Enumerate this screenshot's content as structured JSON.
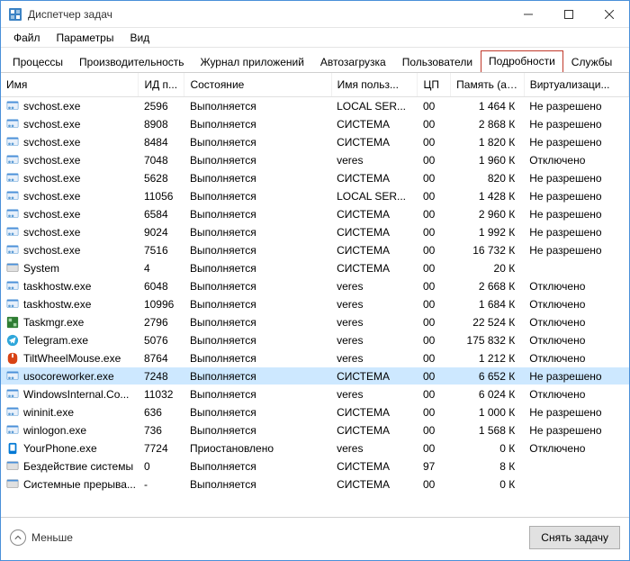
{
  "window": {
    "title": "Диспетчер задач"
  },
  "menu": {
    "file": "Файл",
    "options": "Параметры",
    "view": "Вид"
  },
  "tabs": {
    "processes": "Процессы",
    "performance": "Производительность",
    "app_history": "Журнал приложений",
    "startup": "Автозагрузка",
    "users": "Пользователи",
    "details": "Подробности",
    "services": "Службы",
    "active": "details"
  },
  "columns": {
    "name": "Имя",
    "pid": "ИД п...",
    "state": "Состояние",
    "user": "Имя польз...",
    "cpu": "ЦП",
    "mem": "Память (ак...",
    "virt": "Виртуализаци..."
  },
  "footer": {
    "fewer": "Меньше",
    "end_task": "Снять задачу"
  },
  "rows": [
    {
      "icon": "svc",
      "name": "svchost.exe",
      "pid": "2596",
      "state": "Выполняется",
      "user": "LOCAL SER...",
      "cpu": "00",
      "mem": "1 464 К",
      "virt": "Не разрешено"
    },
    {
      "icon": "svc",
      "name": "svchost.exe",
      "pid": "8908",
      "state": "Выполняется",
      "user": "СИСТЕМА",
      "cpu": "00",
      "mem": "2 868 К",
      "virt": "Не разрешено"
    },
    {
      "icon": "svc",
      "name": "svchost.exe",
      "pid": "8484",
      "state": "Выполняется",
      "user": "СИСТЕМА",
      "cpu": "00",
      "mem": "1 820 К",
      "virt": "Не разрешено"
    },
    {
      "icon": "svc",
      "name": "svchost.exe",
      "pid": "7048",
      "state": "Выполняется",
      "user": "veres",
      "cpu": "00",
      "mem": "1 960 К",
      "virt": "Отключено"
    },
    {
      "icon": "svc",
      "name": "svchost.exe",
      "pid": "5628",
      "state": "Выполняется",
      "user": "СИСТЕМА",
      "cpu": "00",
      "mem": "820 К",
      "virt": "Не разрешено"
    },
    {
      "icon": "svc",
      "name": "svchost.exe",
      "pid": "11056",
      "state": "Выполняется",
      "user": "LOCAL SER...",
      "cpu": "00",
      "mem": "1 428 К",
      "virt": "Не разрешено"
    },
    {
      "icon": "svc",
      "name": "svchost.exe",
      "pid": "6584",
      "state": "Выполняется",
      "user": "СИСТЕМА",
      "cpu": "00",
      "mem": "2 960 К",
      "virt": "Не разрешено"
    },
    {
      "icon": "svc",
      "name": "svchost.exe",
      "pid": "9024",
      "state": "Выполняется",
      "user": "СИСТЕМА",
      "cpu": "00",
      "mem": "1 992 К",
      "virt": "Не разрешено"
    },
    {
      "icon": "svc",
      "name": "svchost.exe",
      "pid": "7516",
      "state": "Выполняется",
      "user": "СИСТЕМА",
      "cpu": "00",
      "mem": "16 732 К",
      "virt": "Не разрешено"
    },
    {
      "icon": "sys",
      "name": "System",
      "pid": "4",
      "state": "Выполняется",
      "user": "СИСТЕМА",
      "cpu": "00",
      "mem": "20 К",
      "virt": ""
    },
    {
      "icon": "svc",
      "name": "taskhostw.exe",
      "pid": "6048",
      "state": "Выполняется",
      "user": "veres",
      "cpu": "00",
      "mem": "2 668 К",
      "virt": "Отключено"
    },
    {
      "icon": "svc",
      "name": "taskhostw.exe",
      "pid": "10996",
      "state": "Выполняется",
      "user": "veres",
      "cpu": "00",
      "mem": "1 684 К",
      "virt": "Отключено"
    },
    {
      "icon": "tm",
      "name": "Taskmgr.exe",
      "pid": "2796",
      "state": "Выполняется",
      "user": "veres",
      "cpu": "00",
      "mem": "22 524 К",
      "virt": "Отключено"
    },
    {
      "icon": "tg",
      "name": "Telegram.exe",
      "pid": "5076",
      "state": "Выполняется",
      "user": "veres",
      "cpu": "00",
      "mem": "175 832 К",
      "virt": "Отключено"
    },
    {
      "icon": "twm",
      "name": "TiltWheelMouse.exe",
      "pid": "8764",
      "state": "Выполняется",
      "user": "veres",
      "cpu": "00",
      "mem": "1 212 К",
      "virt": "Отключено"
    },
    {
      "icon": "svc",
      "name": "usocoreworker.exe",
      "pid": "7248",
      "state": "Выполняется",
      "user": "СИСТЕМА",
      "cpu": "00",
      "mem": "6 652 К",
      "virt": "Не разрешено",
      "selected": true
    },
    {
      "icon": "svc",
      "name": "WindowsInternal.Co...",
      "pid": "11032",
      "state": "Выполняется",
      "user": "veres",
      "cpu": "00",
      "mem": "6 024 К",
      "virt": "Отключено"
    },
    {
      "icon": "svc",
      "name": "wininit.exe",
      "pid": "636",
      "state": "Выполняется",
      "user": "СИСТЕМА",
      "cpu": "00",
      "mem": "1 000 К",
      "virt": "Не разрешено"
    },
    {
      "icon": "svc",
      "name": "winlogon.exe",
      "pid": "736",
      "state": "Выполняется",
      "user": "СИСТЕМА",
      "cpu": "00",
      "mem": "1 568 К",
      "virt": "Не разрешено"
    },
    {
      "icon": "yp",
      "name": "YourPhone.exe",
      "pid": "7724",
      "state": "Приостановлено",
      "user": "veres",
      "cpu": "00",
      "mem": "0 К",
      "virt": "Отключено"
    },
    {
      "icon": "sys",
      "name": "Бездействие системы",
      "pid": "0",
      "state": "Выполняется",
      "user": "СИСТЕМА",
      "cpu": "97",
      "mem": "8 К",
      "virt": ""
    },
    {
      "icon": "sys",
      "name": "Системные прерыва...",
      "pid": "-",
      "state": "Выполняется",
      "user": "СИСТЕМА",
      "cpu": "00",
      "mem": "0 К",
      "virt": ""
    }
  ]
}
